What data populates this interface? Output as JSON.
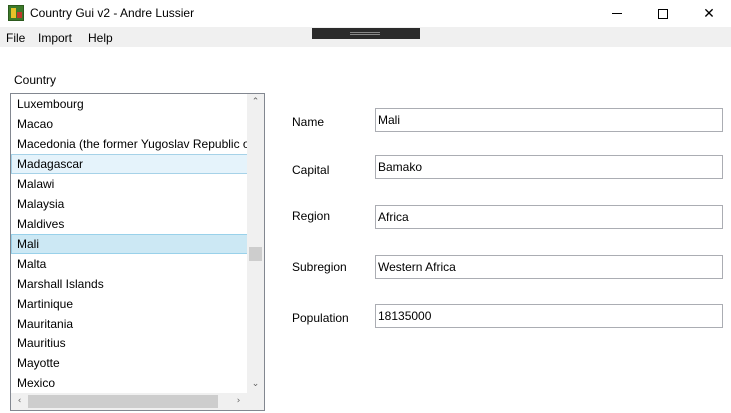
{
  "window": {
    "title": "Country Gui v2 - Andre Lussier",
    "minimize": "minimize",
    "maximize": "maximize",
    "close": "✕"
  },
  "menu": {
    "file": "File",
    "import": "Import",
    "help": "Help"
  },
  "list": {
    "label": "Country",
    "items": [
      "Luxembourg",
      "Macao",
      "Macedonia (the former Yugoslav Republic of",
      "Madagascar",
      "Malawi",
      "Malaysia",
      "Maldives",
      "Mali",
      "Malta",
      "Marshall Islands",
      "Martinique",
      "Mauritania",
      "Mauritius",
      "Mayotte",
      "Mexico"
    ],
    "selected": "Mali",
    "hovered": "Madagascar",
    "scroll_up": "⌃",
    "scroll_down": "⌄",
    "scroll_left": "‹",
    "scroll_right": "›"
  },
  "details": {
    "name_label": "Name",
    "name_value": "Mali",
    "capital_label": "Capital",
    "capital_value": "Bamako",
    "region_label": "Region",
    "region_value": "Africa",
    "subregion_label": "Subregion",
    "subregion_value": "Western Africa",
    "population_label": "Population",
    "population_value": "18135000"
  }
}
